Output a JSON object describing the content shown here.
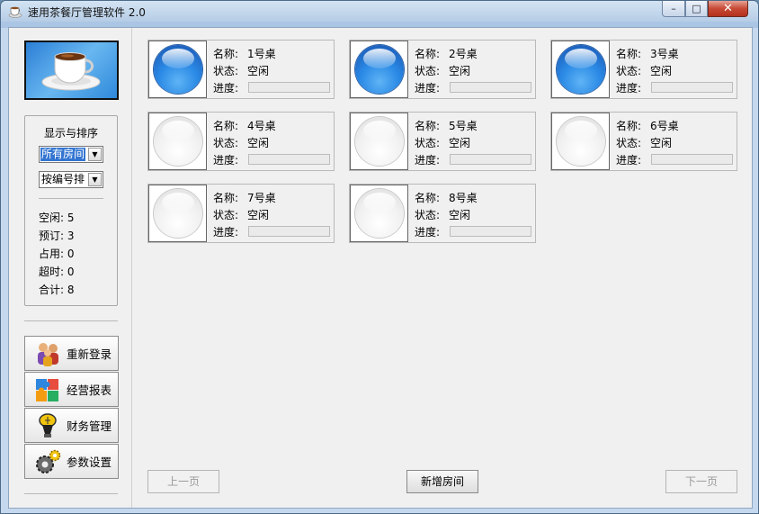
{
  "window": {
    "title": "速用茶餐厅管理软件 2.0",
    "buttons": {
      "minimize": "–",
      "maximize": "□",
      "close": "✕"
    }
  },
  "sidebar": {
    "group_title": "显示与排序",
    "filter_value": "所有房间",
    "sort_value": "按编号排",
    "stats": [
      {
        "label": "空闲:",
        "value": "5"
      },
      {
        "label": "预订:",
        "value": "3"
      },
      {
        "label": "占用:",
        "value": "0"
      },
      {
        "label": "超时:",
        "value": "0"
      },
      {
        "label": "合计:",
        "value": "8"
      }
    ],
    "nav": [
      {
        "label": "重新登录",
        "icon": "users-icon"
      },
      {
        "label": "经营报表",
        "icon": "puzzle-icon"
      },
      {
        "label": "财务管理",
        "icon": "lamp-icon"
      },
      {
        "label": "参数设置",
        "icon": "gears-icon"
      }
    ]
  },
  "field_labels": {
    "name": "名称:",
    "status": "状态:",
    "progress": "进度:"
  },
  "tables": [
    {
      "name": "1号桌",
      "status": "空闲",
      "state": "blue"
    },
    {
      "name": "2号桌",
      "status": "空闲",
      "state": "blue"
    },
    {
      "name": "3号桌",
      "status": "空闲",
      "state": "blue"
    },
    {
      "name": "4号桌",
      "status": "空闲",
      "state": "gray"
    },
    {
      "name": "5号桌",
      "status": "空闲",
      "state": "gray"
    },
    {
      "name": "6号桌",
      "status": "空闲",
      "state": "gray"
    },
    {
      "name": "7号桌",
      "status": "空闲",
      "state": "gray"
    },
    {
      "name": "8号桌",
      "status": "空闲",
      "state": "gray"
    }
  ],
  "bottom": {
    "prev": "上一页",
    "add": "新增房间",
    "next": "下一页"
  }
}
